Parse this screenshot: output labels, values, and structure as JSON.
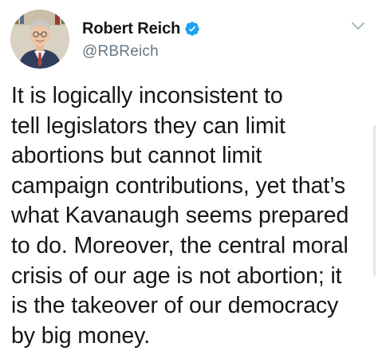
{
  "tweet": {
    "author": {
      "display_name": "Robert Reich",
      "handle": "@RBReich",
      "verified": true,
      "avatar_icon": "avatar-photo"
    },
    "text": "It is logically inconsistent to\ntell legislators they can limit\nabortions but cannot limit\ncampaign contributions, yet that’s\nwhat Kavanaugh seems prepared\nto do. Moreover, the central moral\ncrisis of our age is not abortion; it\nis the takeover of our democracy\nby big money.",
    "menu_icon": "chevron-down-icon"
  },
  "colors": {
    "text_primary": "#14171a",
    "text_secondary": "#657786",
    "verified_blue": "#1da1f2",
    "chevron_gray": "#aab8c2"
  }
}
